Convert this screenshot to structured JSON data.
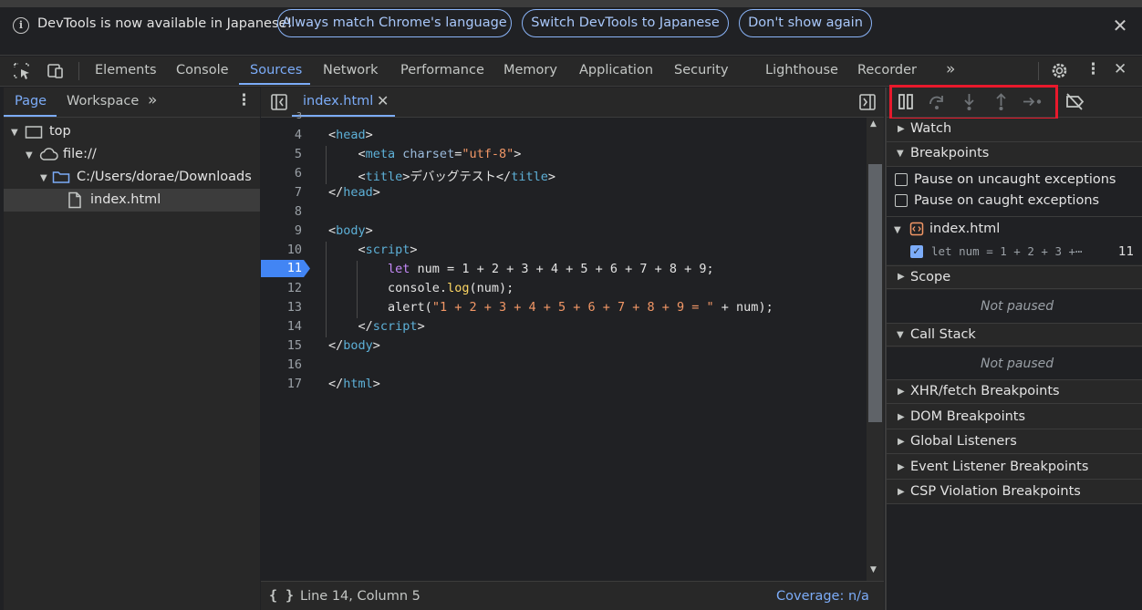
{
  "info_bar": {
    "message": "DevTools is now available in Japanese!",
    "buttons": [
      "Always match Chrome's language",
      "Switch DevTools to Japanese",
      "Don't show again"
    ]
  },
  "main_tabs": {
    "items": [
      "Elements",
      "Console",
      "Sources",
      "Network",
      "Performance",
      "Memory",
      "Application",
      "Security",
      "Lighthouse",
      "Recorder"
    ],
    "active": "Sources"
  },
  "navigator": {
    "tabs": [
      "Page",
      "Workspace"
    ],
    "active": "Page",
    "tree": {
      "top": "top",
      "origin": "file://",
      "folder": "C:/Users/dorae/Downloads",
      "file": "index.html"
    }
  },
  "editor": {
    "tab_label": "index.html",
    "partial_line_number": "3",
    "line_numbers": [
      "4",
      "5",
      "6",
      "7",
      "8",
      "9",
      "10",
      "11",
      "12",
      "13",
      "14",
      "15",
      "16",
      "17"
    ],
    "breakpoint_line": "11",
    "code": {
      "l4_tag": "head",
      "l5_tag": "meta",
      "l5_attr": "charset",
      "l5_value": "\"utf-8\"",
      "l6_tag": "title",
      "l6_text": "デバッグテスト",
      "l7_tag": "head",
      "l9_tag": "body",
      "l10_tag": "script",
      "l11_keyword": "let",
      "l11_rest": " num = 1 + 2 + 3 + 4 + 5 + 6 + 7 + 8 + 9;",
      "l12_obj": "console.",
      "l12_fn": "log",
      "l12_rest": "(num);",
      "l13_fn": "alert(",
      "l13_str": "\"1 + 2 + 3 + 4 + 5 + 6 + 7 + 8 + 9 = \"",
      "l13_rest": " + num);",
      "l14_tag": "script",
      "l15_tag": "body",
      "l17_tag": "html"
    },
    "status": {
      "position": "Line 14, Column 5",
      "coverage": "Coverage: n/a"
    }
  },
  "debugger": {
    "watch": "Watch",
    "breakpoints": "Breakpoints",
    "pause_uncaught": "Pause on uncaught exceptions",
    "pause_caught": "Pause on caught exceptions",
    "bp_file": "index.html",
    "bp_snippet": "let num = 1 + 2 + 3 +⋯",
    "bp_line": "11",
    "scope": "Scope",
    "scope_status": "Not paused",
    "call_stack": "Call Stack",
    "call_stack_status": "Not paused",
    "other_sections": [
      "XHR/fetch Breakpoints",
      "DOM Breakpoints",
      "Global Listeners",
      "Event Listener Breakpoints",
      "CSP Violation Breakpoints"
    ]
  },
  "colors": {
    "accent": "#7cacf8",
    "highlight_box": "#e8192c",
    "breakpoint": "#4285f4"
  }
}
